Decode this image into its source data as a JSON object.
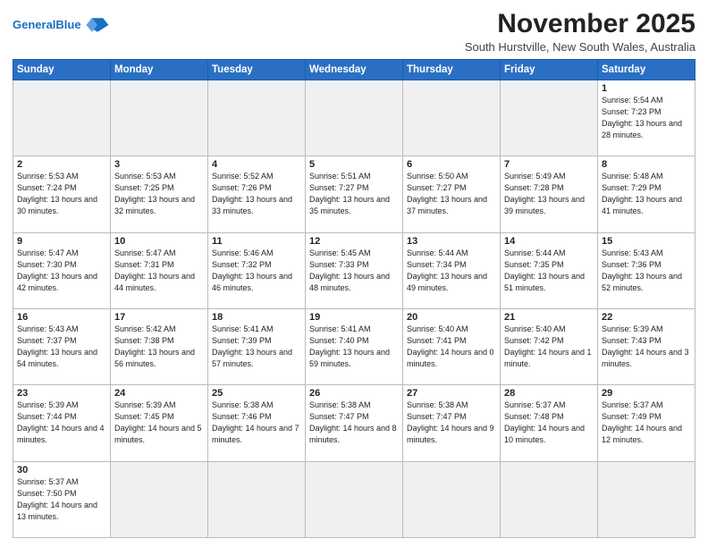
{
  "header": {
    "title": "November 2025",
    "subtitle": "South Hurstville, New South Wales, Australia",
    "logo_general": "General",
    "logo_blue": "Blue"
  },
  "weekdays": [
    "Sunday",
    "Monday",
    "Tuesday",
    "Wednesday",
    "Thursday",
    "Friday",
    "Saturday"
  ],
  "weeks": [
    [
      {
        "day": "",
        "info": ""
      },
      {
        "day": "",
        "info": ""
      },
      {
        "day": "",
        "info": ""
      },
      {
        "day": "",
        "info": ""
      },
      {
        "day": "",
        "info": ""
      },
      {
        "day": "",
        "info": ""
      },
      {
        "day": "1",
        "info": "Sunrise: 5:54 AM\nSunset: 7:23 PM\nDaylight: 13 hours\nand 28 minutes."
      }
    ],
    [
      {
        "day": "2",
        "info": "Sunrise: 5:53 AM\nSunset: 7:24 PM\nDaylight: 13 hours\nand 30 minutes."
      },
      {
        "day": "3",
        "info": "Sunrise: 5:53 AM\nSunset: 7:25 PM\nDaylight: 13 hours\nand 32 minutes."
      },
      {
        "day": "4",
        "info": "Sunrise: 5:52 AM\nSunset: 7:26 PM\nDaylight: 13 hours\nand 33 minutes."
      },
      {
        "day": "5",
        "info": "Sunrise: 5:51 AM\nSunset: 7:27 PM\nDaylight: 13 hours\nand 35 minutes."
      },
      {
        "day": "6",
        "info": "Sunrise: 5:50 AM\nSunset: 7:27 PM\nDaylight: 13 hours\nand 37 minutes."
      },
      {
        "day": "7",
        "info": "Sunrise: 5:49 AM\nSunset: 7:28 PM\nDaylight: 13 hours\nand 39 minutes."
      },
      {
        "day": "8",
        "info": "Sunrise: 5:48 AM\nSunset: 7:29 PM\nDaylight: 13 hours\nand 41 minutes."
      }
    ],
    [
      {
        "day": "9",
        "info": "Sunrise: 5:47 AM\nSunset: 7:30 PM\nDaylight: 13 hours\nand 42 minutes."
      },
      {
        "day": "10",
        "info": "Sunrise: 5:47 AM\nSunset: 7:31 PM\nDaylight: 13 hours\nand 44 minutes."
      },
      {
        "day": "11",
        "info": "Sunrise: 5:46 AM\nSunset: 7:32 PM\nDaylight: 13 hours\nand 46 minutes."
      },
      {
        "day": "12",
        "info": "Sunrise: 5:45 AM\nSunset: 7:33 PM\nDaylight: 13 hours\nand 48 minutes."
      },
      {
        "day": "13",
        "info": "Sunrise: 5:44 AM\nSunset: 7:34 PM\nDaylight: 13 hours\nand 49 minutes."
      },
      {
        "day": "14",
        "info": "Sunrise: 5:44 AM\nSunset: 7:35 PM\nDaylight: 13 hours\nand 51 minutes."
      },
      {
        "day": "15",
        "info": "Sunrise: 5:43 AM\nSunset: 7:36 PM\nDaylight: 13 hours\nand 52 minutes."
      }
    ],
    [
      {
        "day": "16",
        "info": "Sunrise: 5:43 AM\nSunset: 7:37 PM\nDaylight: 13 hours\nand 54 minutes."
      },
      {
        "day": "17",
        "info": "Sunrise: 5:42 AM\nSunset: 7:38 PM\nDaylight: 13 hours\nand 56 minutes."
      },
      {
        "day": "18",
        "info": "Sunrise: 5:41 AM\nSunset: 7:39 PM\nDaylight: 13 hours\nand 57 minutes."
      },
      {
        "day": "19",
        "info": "Sunrise: 5:41 AM\nSunset: 7:40 PM\nDaylight: 13 hours\nand 59 minutes."
      },
      {
        "day": "20",
        "info": "Sunrise: 5:40 AM\nSunset: 7:41 PM\nDaylight: 14 hours\nand 0 minutes."
      },
      {
        "day": "21",
        "info": "Sunrise: 5:40 AM\nSunset: 7:42 PM\nDaylight: 14 hours\nand 1 minute."
      },
      {
        "day": "22",
        "info": "Sunrise: 5:39 AM\nSunset: 7:43 PM\nDaylight: 14 hours\nand 3 minutes."
      }
    ],
    [
      {
        "day": "23",
        "info": "Sunrise: 5:39 AM\nSunset: 7:44 PM\nDaylight: 14 hours\nand 4 minutes."
      },
      {
        "day": "24",
        "info": "Sunrise: 5:39 AM\nSunset: 7:45 PM\nDaylight: 14 hours\nand 5 minutes."
      },
      {
        "day": "25",
        "info": "Sunrise: 5:38 AM\nSunset: 7:46 PM\nDaylight: 14 hours\nand 7 minutes."
      },
      {
        "day": "26",
        "info": "Sunrise: 5:38 AM\nSunset: 7:47 PM\nDaylight: 14 hours\nand 8 minutes."
      },
      {
        "day": "27",
        "info": "Sunrise: 5:38 AM\nSunset: 7:47 PM\nDaylight: 14 hours\nand 9 minutes."
      },
      {
        "day": "28",
        "info": "Sunrise: 5:37 AM\nSunset: 7:48 PM\nDaylight: 14 hours\nand 10 minutes."
      },
      {
        "day": "29",
        "info": "Sunrise: 5:37 AM\nSunset: 7:49 PM\nDaylight: 14 hours\nand 12 minutes."
      }
    ],
    [
      {
        "day": "30",
        "info": "Sunrise: 5:37 AM\nSunset: 7:50 PM\nDaylight: 14 hours\nand 13 minutes."
      },
      {
        "day": "",
        "info": ""
      },
      {
        "day": "",
        "info": ""
      },
      {
        "day": "",
        "info": ""
      },
      {
        "day": "",
        "info": ""
      },
      {
        "day": "",
        "info": ""
      },
      {
        "day": "",
        "info": ""
      }
    ]
  ]
}
